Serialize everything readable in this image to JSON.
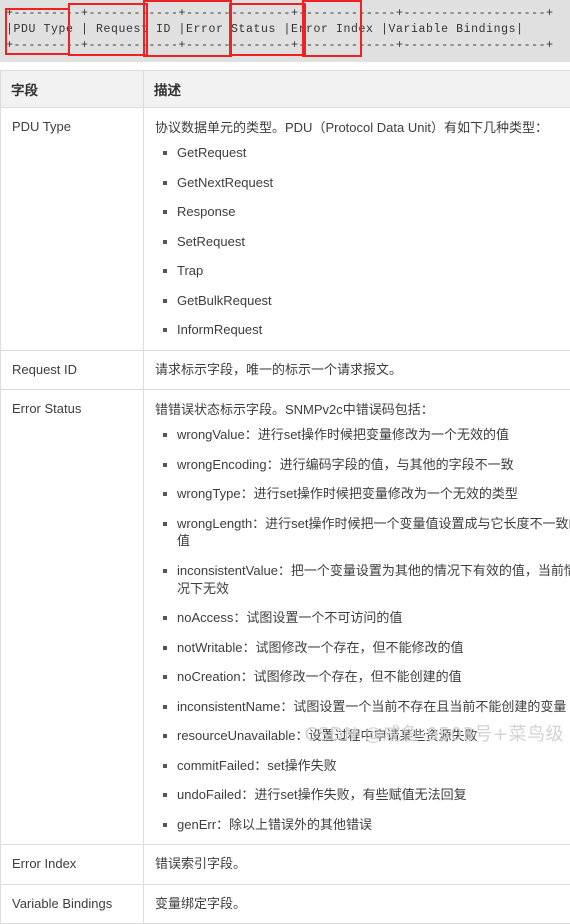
{
  "code_block": {
    "ascii_art": "+---------+------------+--------------+-------------+-------------------+\n|PDU Type | Request ID |Error Status |Error Index |Variable Bindings|\n+---------+------------+--------------+-------------+-------------------+",
    "annotations": [
      {
        "name": "PDU Type"
      },
      {
        "name": "Request ID"
      },
      {
        "name": "Error Status"
      },
      {
        "name": "Error Index"
      },
      {
        "name": "Variable Bindings"
      }
    ],
    "highlight_color": "#ee2222",
    "background_color": "#e0e0e0"
  },
  "table": {
    "headers": [
      "字段",
      "描述"
    ],
    "rows": [
      {
        "field": "PDU Type",
        "intro": "协议数据单元的类型。PDU（Protocol Data Unit）有如下几种类型：",
        "items": [
          "GetRequest",
          "GetNextRequest",
          "Response",
          "SetRequest",
          "Trap",
          "GetBulkRequest",
          "InformRequest"
        ]
      },
      {
        "field": "Request ID",
        "intro": "请求标示字段，唯一的标示一个请求报文。",
        "items": []
      },
      {
        "field": "Error Status",
        "intro": "错错误状态标示字段。SNMPv2c中错误码包括：",
        "items": [
          "wrongValue：进行set操作时候把变量修改为一个无效的值",
          "wrongEncoding：进行编码字段的值，与其他的字段不一致",
          "wrongType：进行set操作时候把变量修改为一个无效的类型",
          "wrongLength：进行set操作时候把一个变量值设置成与它长度不一致的值",
          "inconsistentValue：把一个变量设置为其他的情况下有效的值，当前情况下无效",
          "noAccess：试图设置一个不可访问的值",
          "notWritable：试图修改一个存在，但不能修改的值",
          "noCreation：试图修改一个存在，但不能创建的值",
          "inconsistentName：试图设置一个当前不存在且当前不能创建的变量",
          "resourceUnavailable：设置过程中申请某些资源失败",
          "commitFailed：set操作失败",
          "undoFailed：进行set操作失败，有些赋值无法回复",
          "genErr：除以上错误外的其他错误"
        ]
      },
      {
        "field": "Error Index",
        "intro": "错误索引字段。",
        "items": []
      },
      {
        "field": "Variable Bindings",
        "intro": "变量绑定字段。",
        "items": []
      }
    ]
  },
  "watermark": {
    "text": "CSDN @咸鱼-9503号+菜鸟级"
  }
}
